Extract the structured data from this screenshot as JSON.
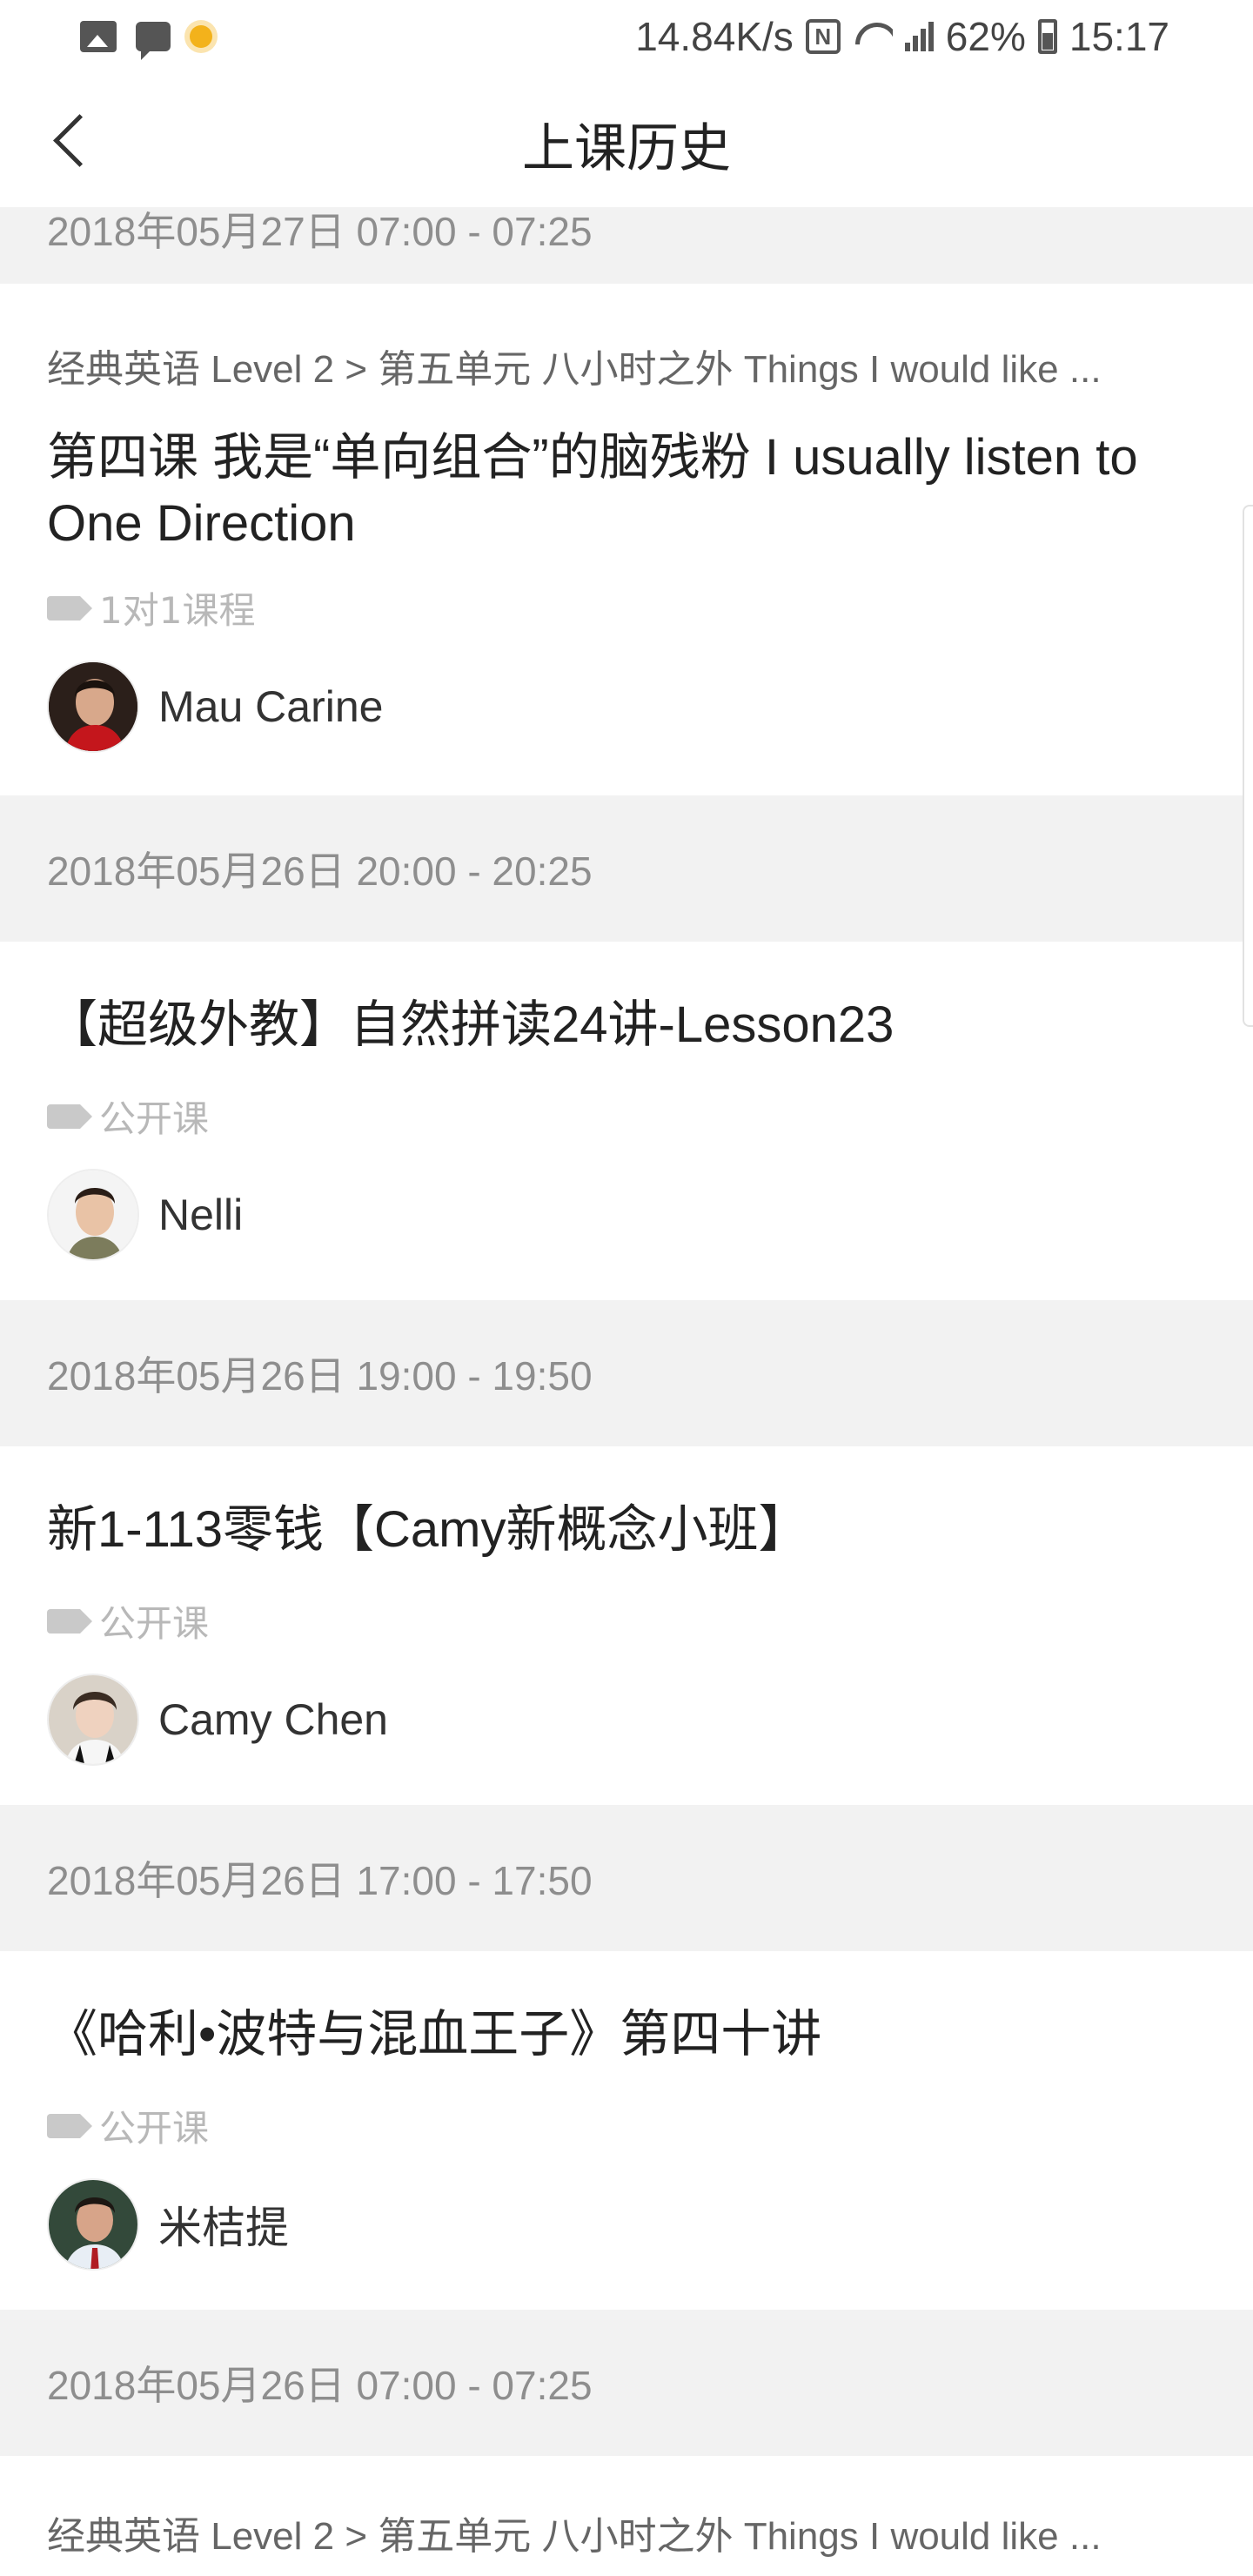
{
  "status_bar": {
    "network_speed": "14.84K/s",
    "nfc_label": "N",
    "battery": "62%",
    "time": "15:17",
    "icons": [
      "image-icon",
      "message-icon",
      "weather-sun-icon",
      "nfc-icon",
      "wifi-icon",
      "signal-icon",
      "battery-icon"
    ]
  },
  "header": {
    "title": "上课历史",
    "back_icon": "chevron-left-icon"
  },
  "entries": [
    {
      "date": "2018年05月27日 07:00 - 07:25",
      "path": "经典英语 Level 2 > 第五单元 八小时之外 Things I would like ...",
      "title": "第四课 我是“单向组合”的脑残粉 I usually listen to One Direction",
      "tag": "1对1课程",
      "teacher": "Mau Carine"
    },
    {
      "date": "2018年05月26日 20:00 - 20:25",
      "title": "【超级外教】自然拼读24讲-Lesson23",
      "tag": "公开课",
      "teacher": "Nelli"
    },
    {
      "date": "2018年05月26日 19:00 - 19:50",
      "title": "新1-113零钱【Camy新概念小班】",
      "tag": "公开课",
      "teacher": "Camy Chen"
    },
    {
      "date": "2018年05月26日 17:00 - 17:50",
      "title": "《哈利•波特与混血王子》第四十讲",
      "tag": "公开课",
      "teacher": "米桔提"
    },
    {
      "date": "2018年05月26日 07:00 - 07:25",
      "path": "经典英语 Level 2 > 第五单元 八小时之外 Things I would like ..."
    }
  ],
  "colors": {
    "background": "#ffffff",
    "date_bar": "#f2f2f2",
    "date_text": "#8e8e8e",
    "tag_text": "#b8b8b8",
    "title_text": "#222222"
  }
}
